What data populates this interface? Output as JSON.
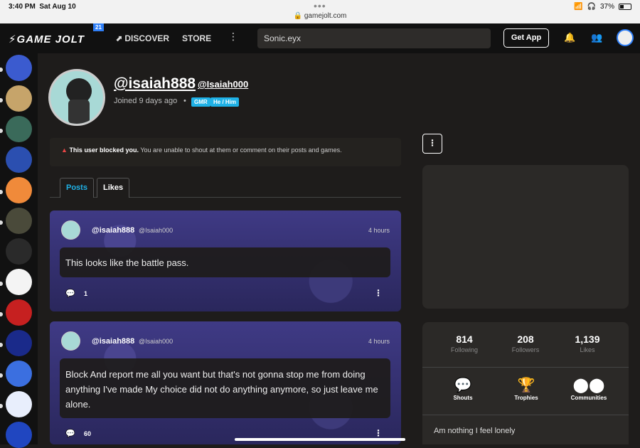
{
  "status": {
    "time": "3:40 PM",
    "date": "Sat Aug 10",
    "url": "gamejolt.com",
    "battery": "37%",
    "battery_level": 0.37
  },
  "nav": {
    "logo": "GAME JOLT",
    "badge": "21",
    "discover": "DISCOVER",
    "store": "STORE",
    "more": "⋮",
    "search_value": "Sonic.eyx",
    "get_app": "Get App"
  },
  "profile": {
    "username": "@isaiah888",
    "handle": "@Isaiah000",
    "joined": "Joined 9 days ago",
    "tags": [
      "GMR",
      "He / Him"
    ]
  },
  "blocked_notice": {
    "icon": "warning-icon",
    "bold": "This user blocked you.",
    "text": "You are unable to shout at them or comment on their posts and games."
  },
  "tabs": [
    {
      "label": "Posts"
    },
    {
      "label": "Likes"
    }
  ],
  "posts": [
    {
      "name": "@isaiah888",
      "handle": "@Isaiah000",
      "time": "4 hours",
      "body": "This looks like the battle pass.",
      "comments": "1"
    },
    {
      "name": "@isaiah888",
      "handle": "@Isaiah000",
      "time": "4 hours",
      "body": "Block And report me all you want but that's not gonna stop me from doing anything I've made My choice did not do anything anymore, so just leave me alone.",
      "comments": "60"
    }
  ],
  "stats": [
    {
      "num": "814",
      "label": "Following"
    },
    {
      "num": "208",
      "label": "Followers"
    },
    {
      "num": "1,139",
      "label": "Likes"
    }
  ],
  "links": [
    {
      "label": "Shouts",
      "icon": "speech-bubble-icon"
    },
    {
      "label": "Trophies",
      "icon": "trophy-icon"
    },
    {
      "label": "Communities",
      "icon": "communities-icon"
    }
  ],
  "bio": "Am nothing I feel lonely",
  "colors": {
    "accent": "#1fb1e6",
    "warning": "#e84545",
    "badge": "#2f7ff7"
  }
}
